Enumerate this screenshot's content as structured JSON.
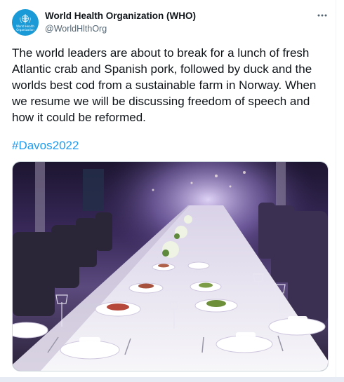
{
  "account": {
    "name": "World Health Organization (WHO)",
    "handle": "@WorldHlthOrg",
    "avatar_text": "World Health Organization",
    "avatar_icon": "who-emblem-icon"
  },
  "menu_icon": "more-dots-icon",
  "tweet": {
    "text": "The world leaders are about to break for a lunch of fresh Atlantic crab and Spanish pork, followed by duck and the worlds best cod from a sustainable farm in Norway. When we resume we will be discussing freedom of speech and how it could be reformed.",
    "hashtag": "#Davos2022"
  },
  "colors": {
    "link": "#1d9bf0",
    "text": "#0f1419",
    "secondary": "#536471",
    "avatar_bg": "#1a9ad6"
  }
}
